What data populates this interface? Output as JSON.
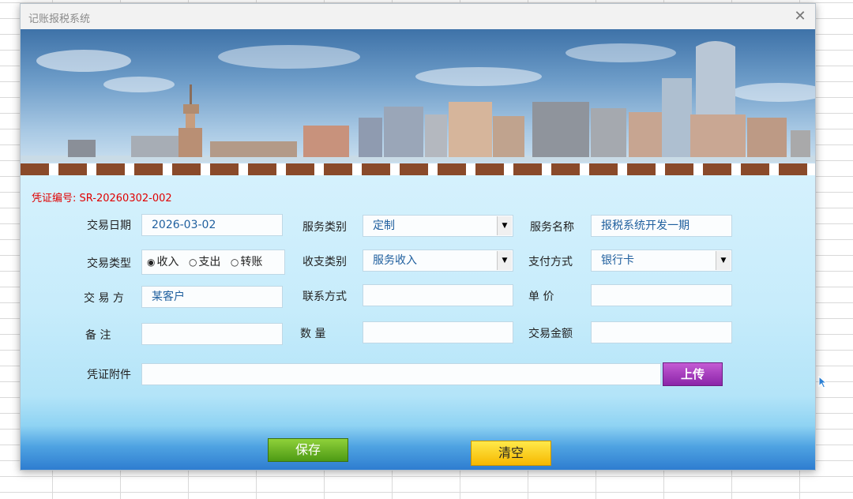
{
  "window": {
    "title": "记账报税系统",
    "close_glyph": "✕"
  },
  "banner": {
    "description_icon": "city-skyline-banner"
  },
  "voucher": {
    "label_value": "凭证编号: SR-20260302-002"
  },
  "labels": {
    "trade_date": "交易日期",
    "trade_type": "交易类型",
    "counterparty": "交 易 方",
    "remark": "备     注",
    "attachment": "凭证附件",
    "service_category": "服务类别",
    "income_expense_category": "收支类别",
    "contact": "联系方式",
    "quantity": "数     量",
    "service_name": "服务名称",
    "payment_method": "支付方式",
    "unit_price": "单     价",
    "trade_amount": "交易金额"
  },
  "fields": {
    "trade_date": "2026-03-02",
    "counterparty": "某客户",
    "remark": "",
    "attachment": "",
    "service_category": "定制",
    "income_expense_category": "服务收入",
    "contact": "",
    "quantity": "",
    "service_name": "报税系统开发一期",
    "payment_method": "银行卡",
    "unit_price": "",
    "trade_amount": ""
  },
  "trade_type": {
    "options": [
      "收入",
      "支出",
      "转账"
    ],
    "selected": "收入"
  },
  "buttons": {
    "upload": "上传",
    "save": "保存",
    "clear": "清空"
  },
  "colors": {
    "voucher_text": "#e00000",
    "field_text": "#1f5f9e",
    "upload_button": "#a63bbf",
    "save_button": "#6db424",
    "clear_button": "#f9d21c"
  }
}
